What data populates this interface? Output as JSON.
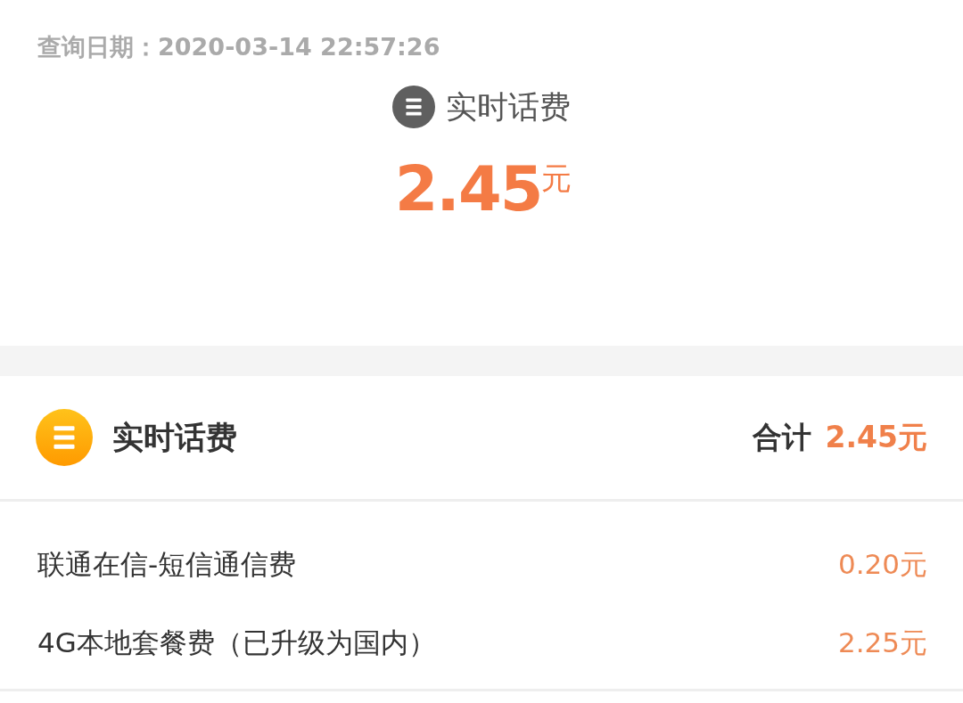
{
  "query_date": "查询日期：2020-03-14 22:57:26",
  "summary": {
    "title": "实时话费",
    "amount": "2.45",
    "unit": "元"
  },
  "detail": {
    "title": "实时话费",
    "total_label": "合计",
    "total_amount": "2.45元",
    "items": [
      {
        "name": "联通在信-短信通信费",
        "amount": "0.20元"
      },
      {
        "name": "4G本地套餐费（已升级为国内）",
        "amount": "2.25元"
      }
    ]
  }
}
